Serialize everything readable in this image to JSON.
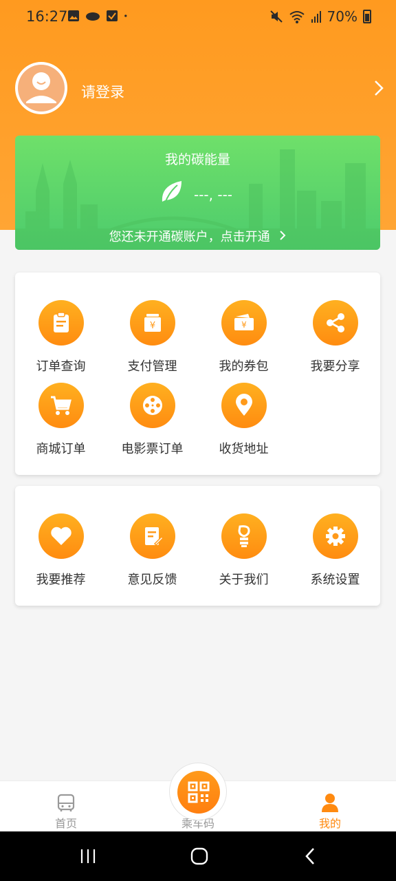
{
  "status_bar": {
    "time": "16:27",
    "battery": "70%",
    "icons": [
      "image-icon",
      "cloud-icon",
      "check-box-icon",
      "dot-icon",
      "mute-icon",
      "wifi-icon",
      "signal-icon",
      "battery-icon"
    ]
  },
  "profile": {
    "login_text": "请登录"
  },
  "carbon": {
    "title": "我的碳能量",
    "value": "---, ---",
    "open_text": "您还未开通碳账户，点击开通"
  },
  "menu1": {
    "items": [
      {
        "label": "订单查询",
        "icon": "clipboard-icon"
      },
      {
        "label": "支付管理",
        "icon": "yuan-box-icon"
      },
      {
        "label": "我的券包",
        "icon": "coupon-icon"
      },
      {
        "label": "我要分享",
        "icon": "share-icon"
      },
      {
        "label": "商城订单",
        "icon": "cart-icon"
      },
      {
        "label": "电影票订单",
        "icon": "film-reel-icon"
      },
      {
        "label": "收货地址",
        "icon": "location-pin-icon"
      }
    ]
  },
  "menu2": {
    "items": [
      {
        "label": "我要推荐",
        "icon": "heart-icon"
      },
      {
        "label": "意见反馈",
        "icon": "edit-note-icon"
      },
      {
        "label": "关于我们",
        "icon": "about-icon"
      },
      {
        "label": "系统设置",
        "icon": "gear-icon"
      }
    ]
  },
  "bottom_nav": {
    "home": "首页",
    "qr": "乘车码",
    "mine": "我的"
  },
  "colors": {
    "accent": "#ff9a1f",
    "green": "#5cd46a",
    "active_tab": "#ff8a10",
    "inactive_tab": "#999999"
  }
}
